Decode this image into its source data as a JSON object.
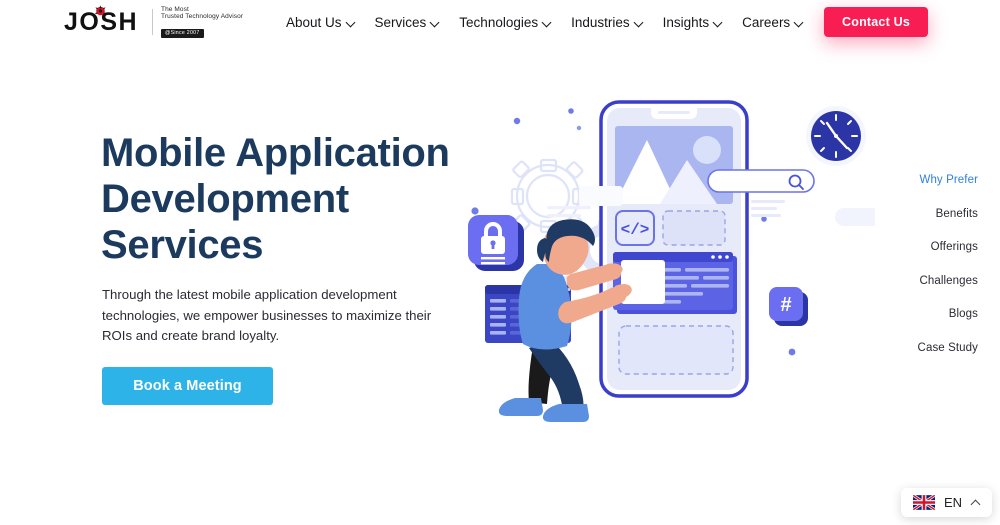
{
  "header": {
    "logo": {
      "wordmark": "JOSH",
      "tagline_line1": "The Most",
      "tagline_line2": "Trusted Technology Advisor",
      "badge": "@Since 2007"
    },
    "nav_items": [
      {
        "label": "About Us",
        "has_dropdown": true
      },
      {
        "label": "Services",
        "has_dropdown": true
      },
      {
        "label": "Technologies",
        "has_dropdown": true
      },
      {
        "label": "Industries",
        "has_dropdown": true
      },
      {
        "label": "Insights",
        "has_dropdown": true
      },
      {
        "label": "Careers",
        "has_dropdown": true
      }
    ],
    "cta": {
      "label": "Contact Us",
      "color": "#f81d53"
    }
  },
  "hero": {
    "title_line1": "Mobile Application",
    "title_line2": "Development",
    "title_line3": "Services",
    "title_color": "#1b3a5e",
    "subtitle": "Through the latest mobile application development technologies, we empower businesses to maximize their ROIs and create brand loyalty.",
    "button": {
      "label": "Book a Meeting",
      "color": "#2eb3e8"
    }
  },
  "section_nav": {
    "items": [
      {
        "label": "Why Prefer",
        "active": true
      },
      {
        "label": "Benefits",
        "active": false
      },
      {
        "label": "Offerings",
        "active": false
      },
      {
        "label": "Challenges",
        "active": false
      },
      {
        "label": "Blogs",
        "active": false
      },
      {
        "label": "Case Study",
        "active": false
      }
    ],
    "active_color": "#2f7fe0"
  },
  "language_selector": {
    "code": "EN",
    "flag": "uk-flag",
    "expanded": true
  },
  "illustration": {
    "description": "Mobile app development concept: man kneeling pushing a card into a smartphone UI",
    "elements": [
      "smartphone-mockup",
      "image-placeholder",
      "code-tile",
      "lock-tile",
      "hash-tile",
      "clock",
      "search-bar",
      "gear-outline",
      "browser-window",
      "list-window",
      "person-illustration"
    ],
    "colors": {
      "primary_blue": "#4f46e5",
      "light_blue": "#aab6ef",
      "pale": "#dfe4fa",
      "navy": "#2a3a96",
      "skin": "#f0a98c",
      "shirt": "#5b8fe0"
    }
  }
}
